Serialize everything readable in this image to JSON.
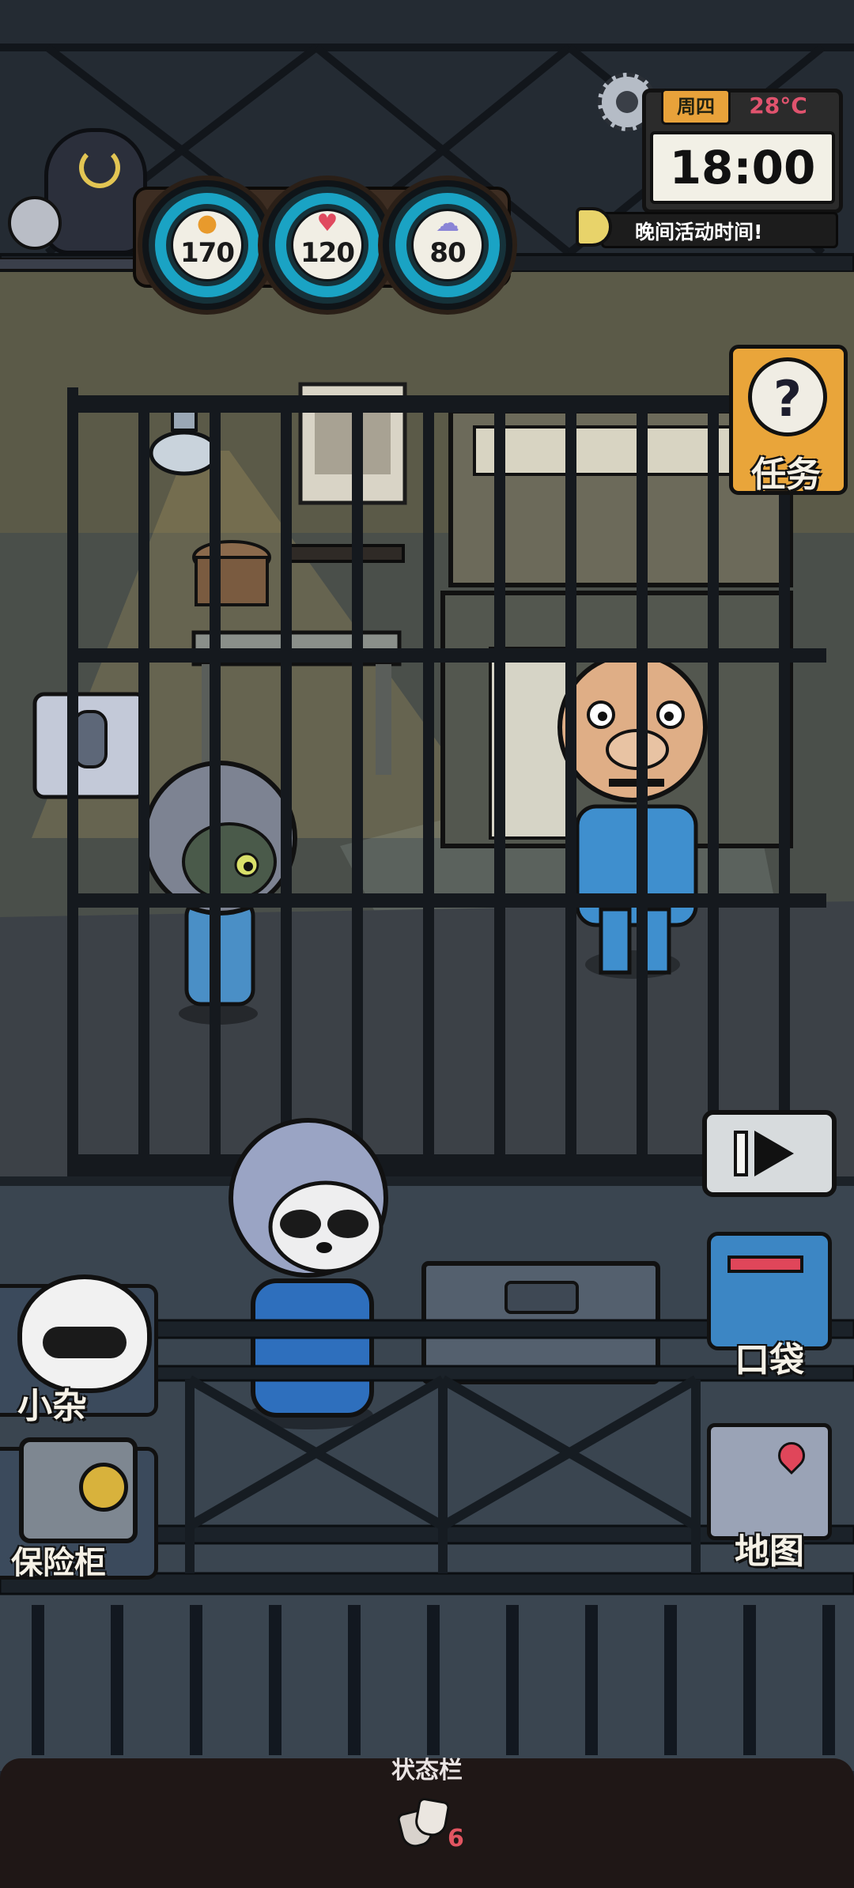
{
  "hud": {
    "stats": [
      {
        "name": "hunger",
        "icon": "food-icon",
        "value": "170",
        "color": "#e89a2c"
      },
      {
        "name": "health",
        "icon": "heart-icon",
        "value": "120",
        "color": "#e04a5f"
      },
      {
        "name": "mental",
        "icon": "brain-icon",
        "value": "80",
        "color": "#8a84d6"
      }
    ],
    "ring_color": "#1aa3c4"
  },
  "clock": {
    "day": "周四",
    "temperature": "28°C",
    "time": "18:00",
    "event": "晚间活动时间!"
  },
  "buttons": {
    "tasks": "任务",
    "pocket": "口袋",
    "map": "地图",
    "companion": "小杂",
    "safe": "保险柜"
  },
  "status_bar": {
    "title": "状态栏",
    "count": "6"
  }
}
